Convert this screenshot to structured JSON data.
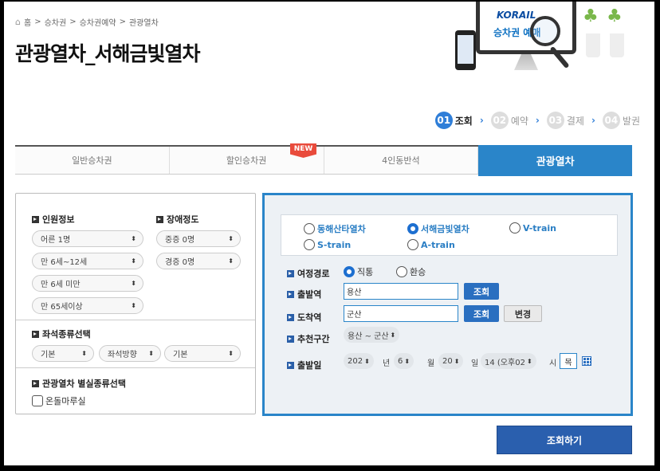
{
  "breadcrumb": [
    "홈",
    "승차권",
    "승차권예약",
    "관광열차"
  ],
  "page_title": "관광열차_서해금빛열차",
  "hero": {
    "logo": "KORAIL",
    "text": "승차권 예매"
  },
  "steps": [
    {
      "num": "01",
      "label": "조회",
      "active": true
    },
    {
      "num": "02",
      "label": "예약",
      "active": false
    },
    {
      "num": "03",
      "label": "결제",
      "active": false
    },
    {
      "num": "04",
      "label": "발권",
      "active": false
    }
  ],
  "tabs": [
    {
      "label": "일반승차권"
    },
    {
      "label": "할인승차권",
      "badge": "NEW"
    },
    {
      "label": "4인동반석"
    },
    {
      "label": "관광열차"
    }
  ],
  "passengers": {
    "title": "인원정보",
    "selects": [
      "어른 1명",
      "만 6세~12세",
      "만 6세 미만",
      "만 65세이상"
    ]
  },
  "disability": {
    "title": "장애정도",
    "selects": [
      "중증 0명",
      "경증 0명"
    ]
  },
  "seat": {
    "title": "좌석종류선택",
    "selects": [
      "기본",
      "좌석방향",
      "기본"
    ]
  },
  "room": {
    "title": "관광열차 별실종류선택",
    "checkbox_label": "온돌마루실"
  },
  "trains": [
    "동해산타열차",
    "서해금빛열차",
    "V-train",
    "S-train",
    "A-train"
  ],
  "route": {
    "label": "여정경로",
    "options": [
      "직통",
      "환승"
    ]
  },
  "departure": {
    "label": "출발역",
    "value": "용산",
    "button": "조회"
  },
  "arrival": {
    "label": "도착역",
    "value": "군산",
    "button": "조회",
    "swap": "변경"
  },
  "recommend": {
    "label": "추천구간",
    "value": "용산 ~ 군산"
  },
  "date": {
    "label": "출발일",
    "year": "202",
    "year_unit": "년",
    "month": "6",
    "month_unit": "월",
    "day": "20",
    "day_unit": "일",
    "hour": "14 (오후02",
    "hour_unit": "시",
    "dow": "목"
  },
  "search_button": "조회하기"
}
